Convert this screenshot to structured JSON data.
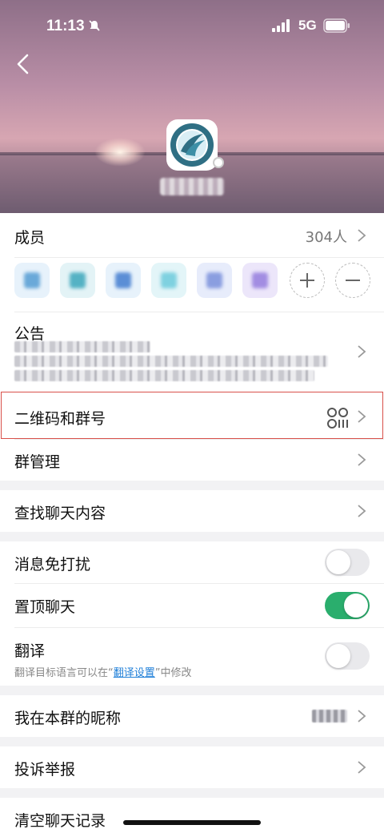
{
  "status_bar": {
    "time": "11:13",
    "network": "5G"
  },
  "colors": {
    "accent_green": "#2aae6d",
    "link_blue": "#1f7fd8",
    "highlight_red": "#d9504a"
  },
  "icons": {
    "back": "chevron-left-icon",
    "mute": "bell-slash-icon",
    "qr": "qr-code-icon",
    "add": "plus-icon",
    "remove": "minus-icon"
  },
  "members": {
    "label": "成员",
    "count": "304人"
  },
  "notice": {
    "label": "公告"
  },
  "qr": {
    "label": "二维码和群号"
  },
  "manage": {
    "label": "群管理"
  },
  "search_history": {
    "label": "查找聊天内容"
  },
  "mute": {
    "label": "消息免打扰",
    "on": false
  },
  "pin": {
    "label": "置顶聊天",
    "on": true
  },
  "translate": {
    "label": "翻译",
    "note_prefix": "翻译目标语言可以在“",
    "note_link": "翻译设置",
    "note_suffix": "”中修改",
    "on": false
  },
  "nickname": {
    "label": "我在本群的昵称"
  },
  "report": {
    "label": "投诉举报"
  },
  "clear": {
    "label": "清空聊天记录"
  }
}
